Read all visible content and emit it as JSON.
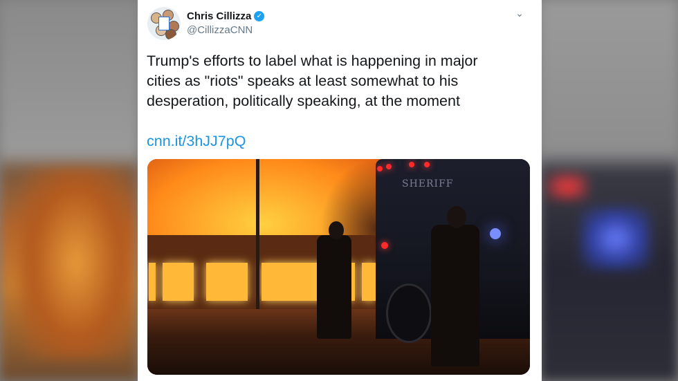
{
  "tweet": {
    "author_name": "Chris Cillizza",
    "handle": "@CillizzaCNN",
    "verified": true,
    "text": "Trump's efforts to label what is happening in major cities as \"riots\" speaks at least somewhat to his desperation, politically speaking, at the moment",
    "link": "cnn.it/3hJJ7pQ",
    "menu_icon": "chevron-down-icon",
    "image_label": "SHERIFF"
  },
  "colors": {
    "link": "#1b95e0",
    "verified_badge": "#1da1f2",
    "handle": "#657786",
    "text": "#14171a"
  }
}
